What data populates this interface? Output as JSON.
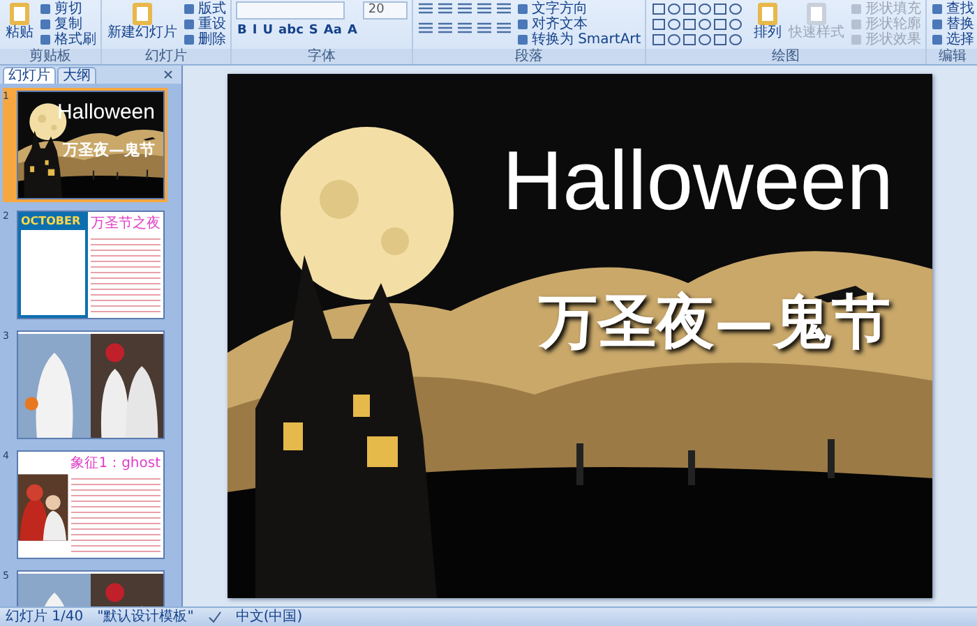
{
  "ribbon": {
    "groups": [
      {
        "label": "剪贴板",
        "columns": [
          [
            {
              "kind": "large",
              "label": "粘贴"
            }
          ],
          [
            {
              "kind": "small",
              "label": "剪切"
            },
            {
              "kind": "small",
              "label": "复制"
            },
            {
              "kind": "small",
              "label": "格式刷"
            }
          ]
        ]
      },
      {
        "label": "幻灯片",
        "columns": [
          [
            {
              "kind": "large",
              "label": "新建幻灯片"
            }
          ],
          [
            {
              "kind": "small",
              "label": "版式"
            },
            {
              "kind": "small",
              "label": "重设"
            },
            {
              "kind": "small",
              "label": "删除"
            }
          ]
        ]
      },
      {
        "label": "字体",
        "columns": [
          [
            {
              "kind": "field"
            },
            {
              "kind": "format",
              "labels": [
                "B",
                "I",
                "U",
                "abc",
                "S",
                "Aa",
                "A"
              ]
            }
          ],
          [
            {
              "kind": "field",
              "value": "20"
            }
          ]
        ]
      },
      {
        "label": "段落",
        "columns": [
          [
            {
              "kind": "icons"
            },
            {
              "kind": "icons"
            }
          ],
          [
            {
              "kind": "small",
              "label": "文字方向"
            },
            {
              "kind": "small",
              "label": "对齐文本"
            },
            {
              "kind": "small",
              "label": "转换为 SmartArt"
            }
          ]
        ]
      },
      {
        "label": "绘图",
        "columns": [
          [
            {
              "kind": "shapes"
            }
          ],
          [
            {
              "kind": "large",
              "label": "排列"
            }
          ],
          [
            {
              "kind": "large",
              "label": "快速样式",
              "disabled": true
            }
          ],
          [
            {
              "kind": "small",
              "label": "形状填充",
              "disabled": true
            },
            {
              "kind": "small",
              "label": "形状轮廓",
              "disabled": true
            },
            {
              "kind": "small",
              "label": "形状效果",
              "disabled": true
            }
          ]
        ]
      },
      {
        "label": "编辑",
        "columns": [
          [
            {
              "kind": "small",
              "label": "查找"
            },
            {
              "kind": "small",
              "label": "替换"
            },
            {
              "kind": "small",
              "label": "选择"
            }
          ]
        ]
      }
    ]
  },
  "pane": {
    "tabs": [
      {
        "label": "幻灯片",
        "selected": true
      },
      {
        "label": "大纲",
        "selected": false
      }
    ],
    "thumbnails": [
      {
        "number": "1",
        "selected": true,
        "kind": "title",
        "title": "Halloween",
        "subtitle": "万圣夜—鬼节"
      },
      {
        "number": "2",
        "selected": false,
        "kind": "calendar",
        "heading": "OCTOBER",
        "title": "万圣节之夜"
      },
      {
        "number": "3",
        "selected": false,
        "kind": "photos"
      },
      {
        "number": "4",
        "selected": false,
        "kind": "photo_text",
        "title": "象征1：ghost"
      },
      {
        "number": "5",
        "selected": false,
        "kind": "photos"
      }
    ]
  },
  "slide": {
    "title": "Halloween",
    "subtitle": "万圣夜—鬼节"
  },
  "status_bar": {
    "items": [
      "幻灯片 1/40",
      "\"默认设计模板\"",
      "中文(中国)"
    ]
  }
}
